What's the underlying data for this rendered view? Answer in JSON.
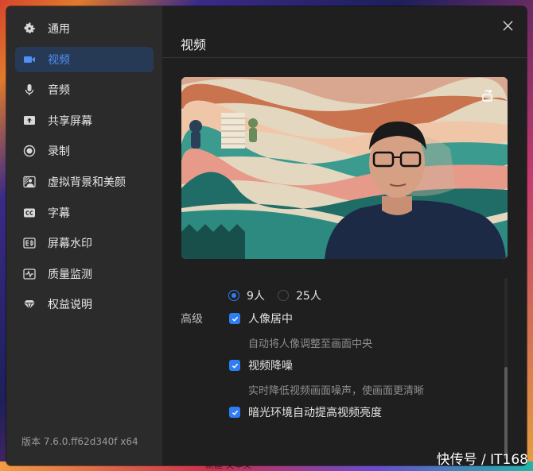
{
  "sidebar": {
    "items": [
      {
        "label": "通用",
        "icon": "gear-icon",
        "active": false
      },
      {
        "label": "视频",
        "icon": "video-camera-icon",
        "active": true
      },
      {
        "label": "音频",
        "icon": "microphone-icon",
        "active": false
      },
      {
        "label": "共享屏幕",
        "icon": "share-screen-icon",
        "active": false
      },
      {
        "label": "录制",
        "icon": "record-icon",
        "active": false
      },
      {
        "label": "虚拟背景和美颜",
        "icon": "virtual-background-icon",
        "active": false
      },
      {
        "label": "字幕",
        "icon": "caption-icon",
        "active": false
      },
      {
        "label": "屏幕水印",
        "icon": "watermark-icon",
        "active": false
      },
      {
        "label": "质量监测",
        "icon": "quality-monitor-icon",
        "active": false
      },
      {
        "label": "权益说明",
        "icon": "diamond-icon",
        "active": false
      }
    ],
    "version": "版本 7.6.0.ff62d340f x64"
  },
  "main": {
    "title": "视频",
    "layout_options": [
      {
        "label": "9人",
        "selected": true
      },
      {
        "label": "25人",
        "selected": false
      }
    ],
    "advanced_label": "高级",
    "options": [
      {
        "label": "人像居中",
        "checked": true,
        "description": "自动将人像调整至画面中央"
      },
      {
        "label": "视频降噪",
        "checked": true,
        "description": "实时降低视频画面噪声，使画面更清晰"
      },
      {
        "label": "暗光环境自动提高视频亮度",
        "checked": true,
        "description": ""
      }
    ]
  },
  "overlay": {
    "watermark": "快传号 / IT168",
    "taskbar_text": "新建 文本文"
  },
  "colors": {
    "accent": "#2f7df3",
    "active_bg": "#273a55",
    "sidebar_bg": "#2b2b2b",
    "main_bg": "#1f1f1f"
  }
}
